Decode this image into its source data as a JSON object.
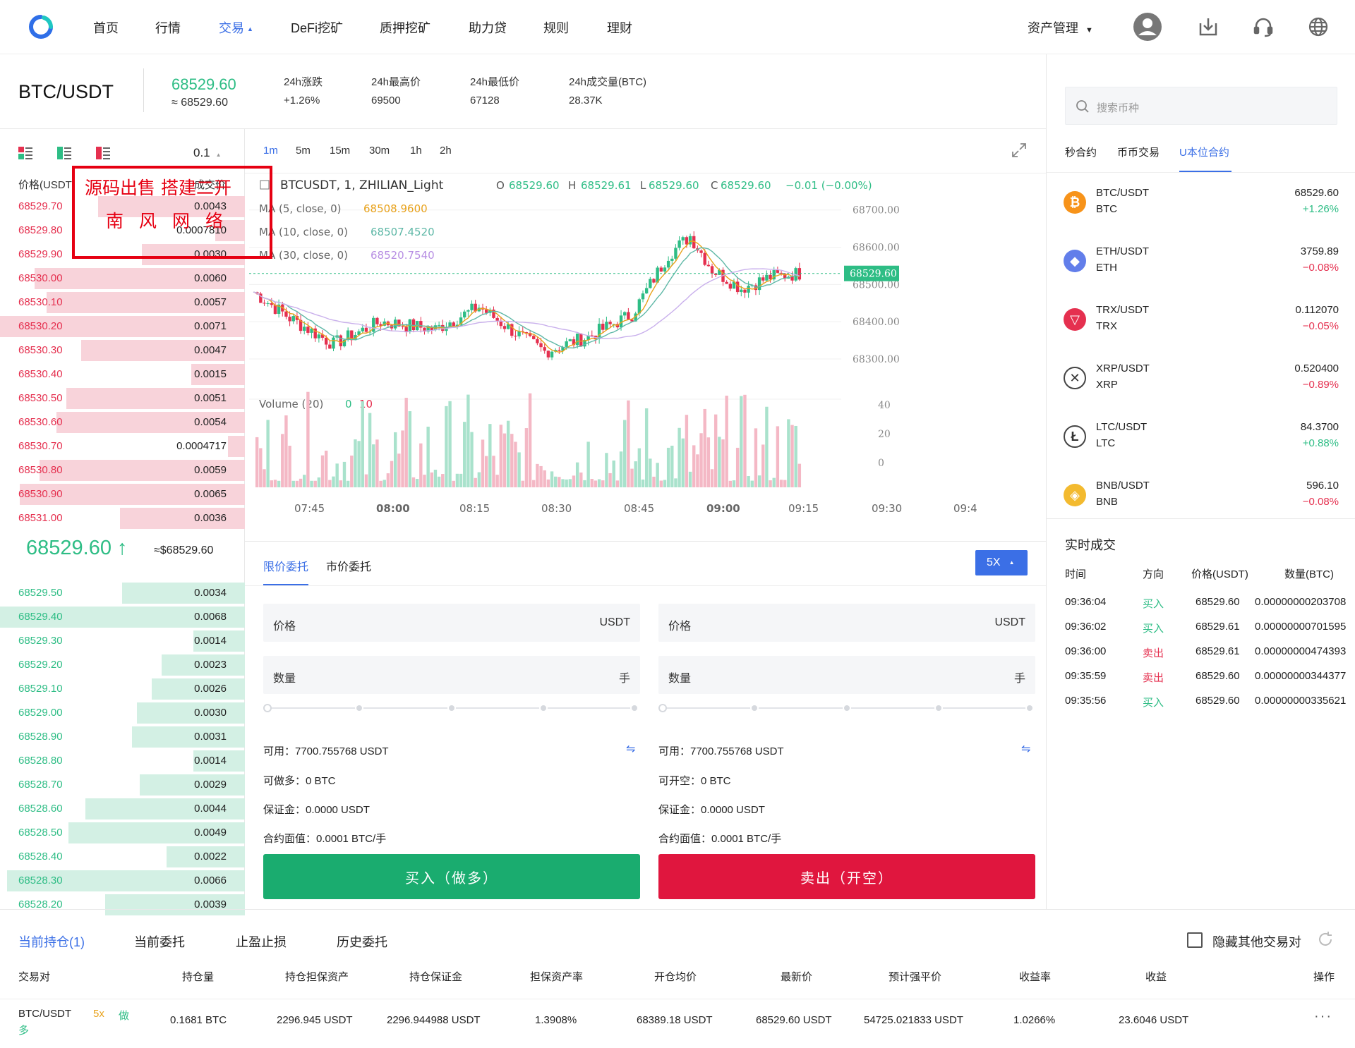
{
  "nav": {
    "items": [
      "首页",
      "行情",
      "交易",
      "DeFi挖矿",
      "质押挖矿",
      "助力贷",
      "规则",
      "理财"
    ],
    "asset": "资产管理"
  },
  "ticker": {
    "pair": "BTC/USDT",
    "price": "68529.60",
    "approx": "≈ 68529.60",
    "stats": [
      {
        "label": "24h涨跌",
        "value": "+1.26%"
      },
      {
        "label": "24h最高价",
        "value": "69500"
      },
      {
        "label": "24h最低价",
        "value": "67128"
      },
      {
        "label": "24h成交量(BTC)",
        "value": "28.37K"
      }
    ]
  },
  "orderbook": {
    "precision": "0.1",
    "head_price": "价格(USDT)",
    "head_qty": "成交价",
    "asks": [
      {
        "p": "68529.70",
        "q": "0.0043",
        "d": 0.6
      },
      {
        "p": "68529.80",
        "q": "0.0007810",
        "d": 0.12
      },
      {
        "p": "68529.90",
        "q": "0.0030",
        "d": 0.42
      },
      {
        "p": "68530.00",
        "q": "0.0060",
        "d": 0.86
      },
      {
        "p": "68530.10",
        "q": "0.0057",
        "d": 0.81
      },
      {
        "p": "68530.20",
        "q": "0.0071",
        "d": 1.0
      },
      {
        "p": "68530.30",
        "q": "0.0047",
        "d": 0.67
      },
      {
        "p": "68530.40",
        "q": "0.0015",
        "d": 0.22
      },
      {
        "p": "68530.50",
        "q": "0.0051",
        "d": 0.73
      },
      {
        "p": "68530.60",
        "q": "0.0054",
        "d": 0.77
      },
      {
        "p": "68530.70",
        "q": "0.0004717",
        "d": 0.07
      },
      {
        "p": "68530.80",
        "q": "0.0059",
        "d": 0.84
      },
      {
        "p": "68530.90",
        "q": "0.0065",
        "d": 0.92
      },
      {
        "p": "68531.00",
        "q": "0.0036",
        "d": 0.51
      }
    ],
    "last": "68529.60",
    "arrow": "↑",
    "last_usd": "≈$68529.60",
    "bids": [
      {
        "p": "68529.50",
        "q": "0.0034",
        "d": 0.5
      },
      {
        "p": "68529.40",
        "q": "0.0068",
        "d": 1.0
      },
      {
        "p": "68529.30",
        "q": "0.0014",
        "d": 0.21
      },
      {
        "p": "68529.20",
        "q": "0.0023",
        "d": 0.34
      },
      {
        "p": "68529.10",
        "q": "0.0026",
        "d": 0.38
      },
      {
        "p": "68529.00",
        "q": "0.0030",
        "d": 0.44
      },
      {
        "p": "68528.90",
        "q": "0.0031",
        "d": 0.46
      },
      {
        "p": "68528.80",
        "q": "0.0014",
        "d": 0.21
      },
      {
        "p": "68528.70",
        "q": "0.0029",
        "d": 0.43
      },
      {
        "p": "68528.60",
        "q": "0.0044",
        "d": 0.65
      },
      {
        "p": "68528.50",
        "q": "0.0049",
        "d": 0.72
      },
      {
        "p": "68528.40",
        "q": "0.0022",
        "d": 0.32
      },
      {
        "p": "68528.30",
        "q": "0.0066",
        "d": 0.97
      },
      {
        "p": "68528.20",
        "q": "0.0039",
        "d": 0.57
      }
    ]
  },
  "chart": {
    "timeframes": [
      "1m",
      "5m",
      "15m",
      "30m",
      "1h",
      "2h"
    ],
    "symbol": "BTCUSDT, 1, ZHILIAN_Light",
    "ohlc": {
      "o": "O",
      "ov": "68529.60",
      "h": "H",
      "hv": "68529.61",
      "l": "L",
      "lv": "68529.60",
      "c": "C",
      "cv": "68529.60",
      "chg": "−0.01 (−0.00%)"
    },
    "ma": [
      {
        "label": "MA (5, close, 0)",
        "value": "68508.9600",
        "color": "#e8a21c"
      },
      {
        "label": "MA (10, close, 0)",
        "value": "68507.4520",
        "color": "#5fb8a7"
      },
      {
        "label": "MA (30, close, 0)",
        "value": "68520.7540",
        "color": "#b78ee3"
      }
    ],
    "price_axis": [
      "68700.00",
      "68600.00",
      "68500.00",
      "68400.00",
      "68300.00"
    ],
    "last_label": "68529.60",
    "volume_label": "Volume (20)",
    "vol_ma": "0",
    "vol_last": "10",
    "vol_axis": [
      "40",
      "20",
      "0"
    ],
    "time_axis": [
      "07:45",
      "08:00",
      "08:15",
      "08:30",
      "08:45",
      "09:00",
      "09:15",
      "09:30",
      "09:4"
    ]
  },
  "order": {
    "tabs": [
      "限价委托",
      "市价委托"
    ],
    "leverage": "5X",
    "buy": {
      "price_label": "价格",
      "price_unit": "USDT",
      "qty_label": "数量",
      "qty_unit": "手",
      "avail": "可用：7700.755768 USDT",
      "max": "可做多：0 BTC",
      "margin": "保证金：0.0000 USDT",
      "face": "合约面值：0.0001 BTC/手",
      "button": "买入（做多）"
    },
    "sell": {
      "price_label": "价格",
      "price_unit": "USDT",
      "qty_label": "数量",
      "qty_unit": "手",
      "avail": "可用：7700.755768 USDT",
      "max": "可开空：0 BTC",
      "margin": "保证金：0.0000 USDT",
      "face": "合约面值：0.0001 BTC/手",
      "button": "卖出（开空）"
    }
  },
  "market": {
    "search_placeholder": "搜索币种",
    "tabs": [
      "秒合约",
      "币币交易",
      "U本位合约"
    ],
    "rows": [
      {
        "pair": "BTC/USDT",
        "sym": "BTC",
        "price": "68529.60",
        "chg": "+1.26%",
        "up": true,
        "icon": "bitcoin-icon",
        "color": "#f7931a",
        "glyph": "₿"
      },
      {
        "pair": "ETH/USDT",
        "sym": "ETH",
        "price": "3759.89",
        "chg": "−0.08%",
        "up": false,
        "icon": "ethereum-icon",
        "color": "#627eea",
        "glyph": "◆"
      },
      {
        "pair": "TRX/USDT",
        "sym": "TRX",
        "price": "0.112070",
        "chg": "−0.05%",
        "up": false,
        "icon": "tron-icon",
        "color": "#e5304f",
        "glyph": "▽"
      },
      {
        "pair": "XRP/USDT",
        "sym": "XRP",
        "price": "0.520400",
        "chg": "−0.89%",
        "up": false,
        "icon": "ripple-icon",
        "color": "#fff",
        "glyph": "✕"
      },
      {
        "pair": "LTC/USDT",
        "sym": "LTC",
        "price": "84.3700",
        "chg": "+0.88%",
        "up": true,
        "icon": "litecoin-icon",
        "color": "#fff",
        "glyph": "Ł"
      },
      {
        "pair": "BNB/USDT",
        "sym": "BNB",
        "price": "596.10",
        "chg": "−0.08%",
        "up": false,
        "icon": "bnb-icon",
        "color": "#f3ba2f",
        "glyph": "◈"
      }
    ]
  },
  "trades": {
    "title": "实时成交",
    "headers": [
      "时间",
      "方向",
      "价格(USDT)",
      "数量(BTC)"
    ],
    "rows": [
      {
        "t": "09:36:04",
        "side": "买入",
        "buy": true,
        "p": "68529.60",
        "q": "0.00000000203708"
      },
      {
        "t": "09:36:02",
        "side": "买入",
        "buy": true,
        "p": "68529.61",
        "q": "0.00000000701595"
      },
      {
        "t": "09:36:00",
        "side": "卖出",
        "buy": false,
        "p": "68529.61",
        "q": "0.00000000474393"
      },
      {
        "t": "09:35:59",
        "side": "卖出",
        "buy": false,
        "p": "68529.60",
        "q": "0.00000000344377"
      },
      {
        "t": "09:35:56",
        "side": "买入",
        "buy": true,
        "p": "68529.60",
        "q": "0.00000000335621"
      }
    ]
  },
  "positions": {
    "tabs": [
      "当前持仓(1)",
      "当前委托",
      "止盈止损",
      "历史委托"
    ],
    "hide_label": "隐藏其他交易对",
    "headers": [
      "交易对",
      "持仓量",
      "持仓担保资产",
      "持仓保证金",
      "担保资产率",
      "开仓均价",
      "最新价",
      "预计强平价",
      "收益率",
      "收益",
      "操作"
    ],
    "row": {
      "pair": "BTC/USDT",
      "lev": "5x",
      "dir": "做",
      "dir2": "多",
      "qty": "0.1681 BTC",
      "collat": "2296.945 USDT",
      "margin": "2296.944988 USDT",
      "ratio": "1.3908%",
      "open": "68389.18 USDT",
      "last": "68529.60 USDT",
      "liq": "54725.021833 USDT",
      "roe": "1.0266%",
      "pnl": "23.6046 USDT",
      "op": "···"
    }
  },
  "watermark": {
    "line1": "源码出售 搭建二开",
    "line2": "南风网络"
  },
  "colors": {
    "up": "#2ebd85",
    "down": "#e5304f",
    "accent": "#3b6fe6",
    "buy_btn": "#1aac6f",
    "sell_btn": "#e0163e"
  }
}
